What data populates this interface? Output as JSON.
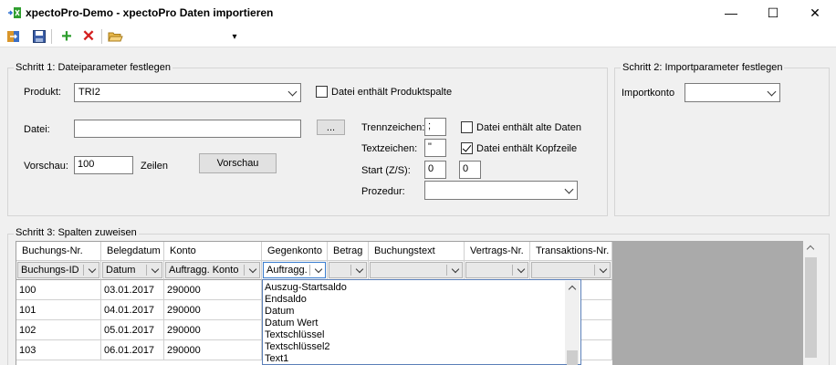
{
  "window": {
    "title": "xpectoPro-Demo - xpectoPro Daten importieren",
    "minimize_glyph": "—",
    "maximize_glyph": "☐",
    "close_glyph": "✕"
  },
  "toolbar": {
    "icons": [
      "exit-icon",
      "save-icon",
      "add-icon",
      "delete-icon",
      "open-folder-icon",
      "dropdown-arrow-icon"
    ],
    "add_glyph": "+",
    "delete_glyph": "✕",
    "dropdown_glyph": "▾"
  },
  "colors": {
    "add_green": "#2e9e2e",
    "delete_red": "#d42020",
    "folder_yellow": "#e8b84a",
    "grid_gray": "#aaaaaa",
    "dropdown_border": "#5a7fb8"
  },
  "step1": {
    "legend": "Schritt 1: Dateiparameter festlegen",
    "produkt_label": "Produkt:",
    "produkt_value": "TRI2",
    "has_product_column_label": "Datei enthält Produktspalte",
    "has_product_column_checked": false,
    "datei_label": "Datei:",
    "datei_value": "",
    "browse_label": "...",
    "vorschau_label": "Vorschau:",
    "vorschau_value": "100",
    "zeilen_label": "Zeilen",
    "vorschau_button": "Vorschau",
    "trennzeichen_label": "Trennzeichen:",
    "trennzeichen_value": ";",
    "textzeichen_label": "Textzeichen:",
    "textzeichen_value": "\"",
    "start_label": "Start (Z/S):",
    "start_z": "0",
    "start_s": "0",
    "prozedur_label": "Prozedur:",
    "prozedur_value": "",
    "old_data_label": "Datei enthält alte Daten",
    "old_data_checked": false,
    "header_row_label": "Datei enthält Kopfzeile",
    "header_row_checked": true
  },
  "step2": {
    "legend": "Schritt 2: Importparameter festlegen",
    "importkonto_label": "Importkonto",
    "importkonto_value": ""
  },
  "step3": {
    "legend": "Schritt 3: Spalten zuweisen",
    "columns": [
      "Buchungs-Nr.",
      "Belegdatum",
      "Konto",
      "Gegenkonto",
      "Betrag",
      "Buchungstext",
      "Vertrags-Nr.",
      "Transaktions-Nr."
    ],
    "mappings": [
      "Buchungs-ID",
      "Datum",
      "Auftragg. Konto",
      "Auftragg. ",
      "",
      "",
      "",
      ""
    ],
    "rows": [
      [
        "100",
        "03.01.2017",
        "290000"
      ],
      [
        "101",
        "04.01.2017",
        "290000"
      ],
      [
        "102",
        "05.01.2017",
        "290000"
      ],
      [
        "103",
        "06.01.2017",
        "290000"
      ]
    ],
    "dropdown_options": [
      "Auszug-Startsaldo",
      "Endsaldo",
      "Datum",
      "Datum Wert",
      "Textschlüssel",
      "Textschlüssel2",
      "Text1"
    ]
  }
}
